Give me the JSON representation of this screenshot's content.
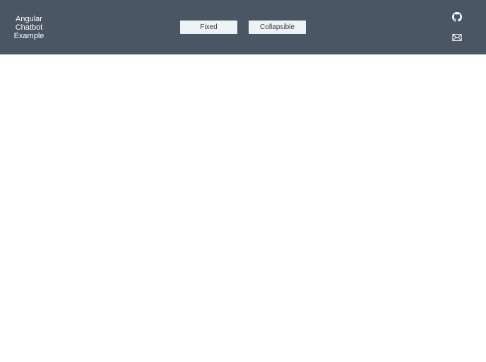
{
  "header": {
    "brand_lines": [
      "Angular",
      "Chatbot",
      "Example"
    ],
    "nav": {
      "fixed_label": "Fixed",
      "collapsible_label": "Collapsible"
    },
    "icons": [
      "github-icon",
      "mail-icon"
    ]
  },
  "colors": {
    "header_bg": "#4a5663",
    "button_bg": "#edf2f5",
    "button_text": "#333b44",
    "page_bg": "#ffffff"
  }
}
